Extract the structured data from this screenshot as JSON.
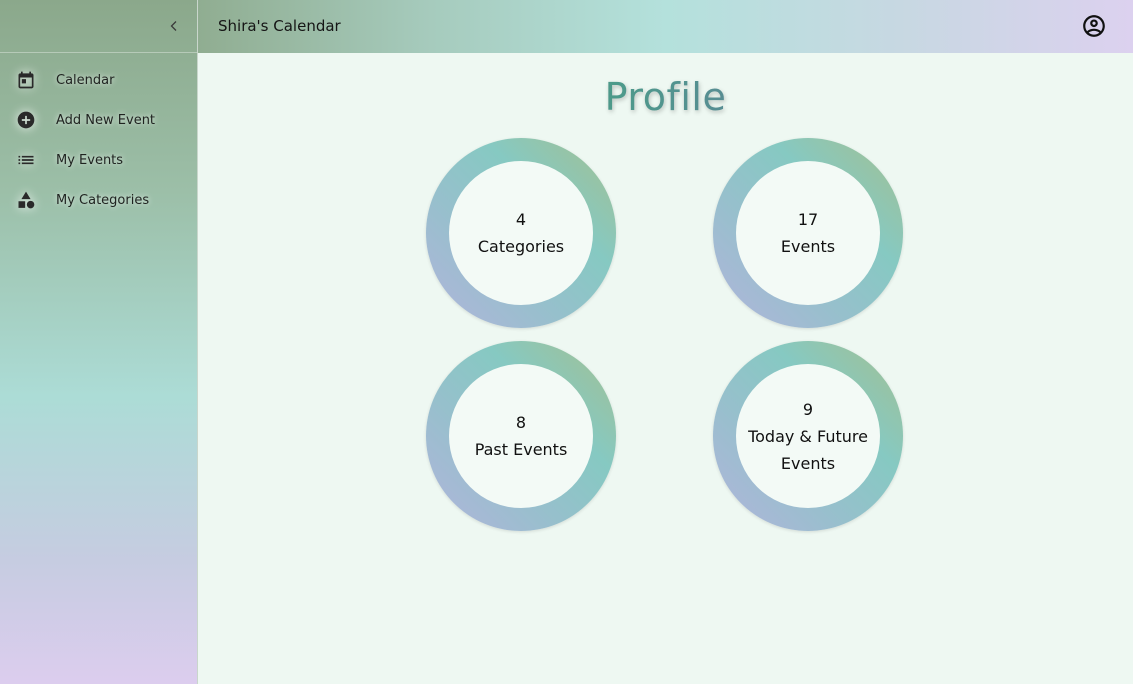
{
  "sidebar": {
    "collapse_icon": "chevron-left-icon",
    "items": [
      {
        "label": "Calendar",
        "icon": "calendar-icon"
      },
      {
        "label": "Add New Event",
        "icon": "add-circle-icon"
      },
      {
        "label": "My Events",
        "icon": "list-icon"
      },
      {
        "label": "My Categories",
        "icon": "category-shapes-icon"
      }
    ]
  },
  "header": {
    "title": "Shira's Calendar",
    "account_icon": "account-circle-icon"
  },
  "main": {
    "title": "Profile",
    "stats": [
      {
        "value": "4",
        "label": "Categories"
      },
      {
        "value": "17",
        "label": "Events"
      },
      {
        "value": "8",
        "label": "Past Events"
      },
      {
        "value": "9",
        "label": "Today & Future Events"
      }
    ]
  },
  "colors": {
    "sidebar_top": "#8ba88b",
    "sidebar_bottom": "#dccdee",
    "accent_teal": "#86c9c2",
    "accent_purple": "#b2b4dc",
    "main_bg": "#eef8f2"
  }
}
